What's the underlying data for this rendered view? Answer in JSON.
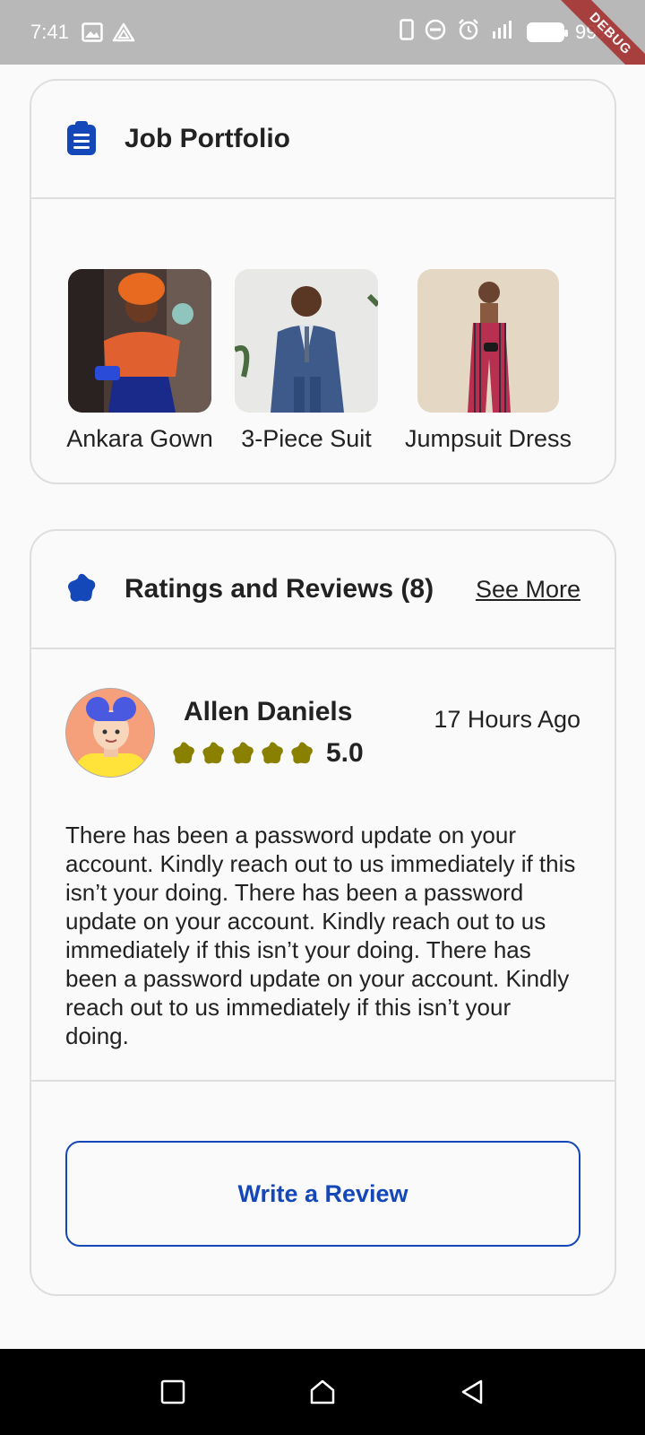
{
  "status_bar": {
    "time": "7:41",
    "battery": "99%",
    "debug_label": "DEBUG",
    "icons": [
      "image-icon",
      "drive-icon",
      "phone-icon",
      "dnd-icon",
      "alarm-icon",
      "signal-icon",
      "battery-icon"
    ]
  },
  "portfolio": {
    "title": "Job Portfolio",
    "icon": "clipboard-icon",
    "items": [
      {
        "label": "Ankara Gown"
      },
      {
        "label": "3-Piece Suit"
      },
      {
        "label": "Jumpsuit Dress"
      }
    ]
  },
  "reviews": {
    "title": "Ratings and Reviews (8)",
    "icon": "badge-icon",
    "see_more": "See More",
    "review": {
      "name": "Allen Daniels",
      "time": "17 Hours Ago",
      "rating": "5.0",
      "stars": 5,
      "body": "There has been a password update on your account. Kindly reach out to us immediately if this isn’t your doing. There has been a password update on your account. Kindly reach out to us immediately if this isn’t your doing. There has been a password update on your account. Kindly reach out to us immediately if this isn’t your doing."
    },
    "write_review": "Write a Review"
  },
  "colors": {
    "accent": "#1448b8",
    "star": "#8a8000",
    "status_bar": "#b8b8b8"
  },
  "nav": {
    "icons": [
      "recent-apps-icon",
      "home-icon",
      "back-icon"
    ]
  }
}
